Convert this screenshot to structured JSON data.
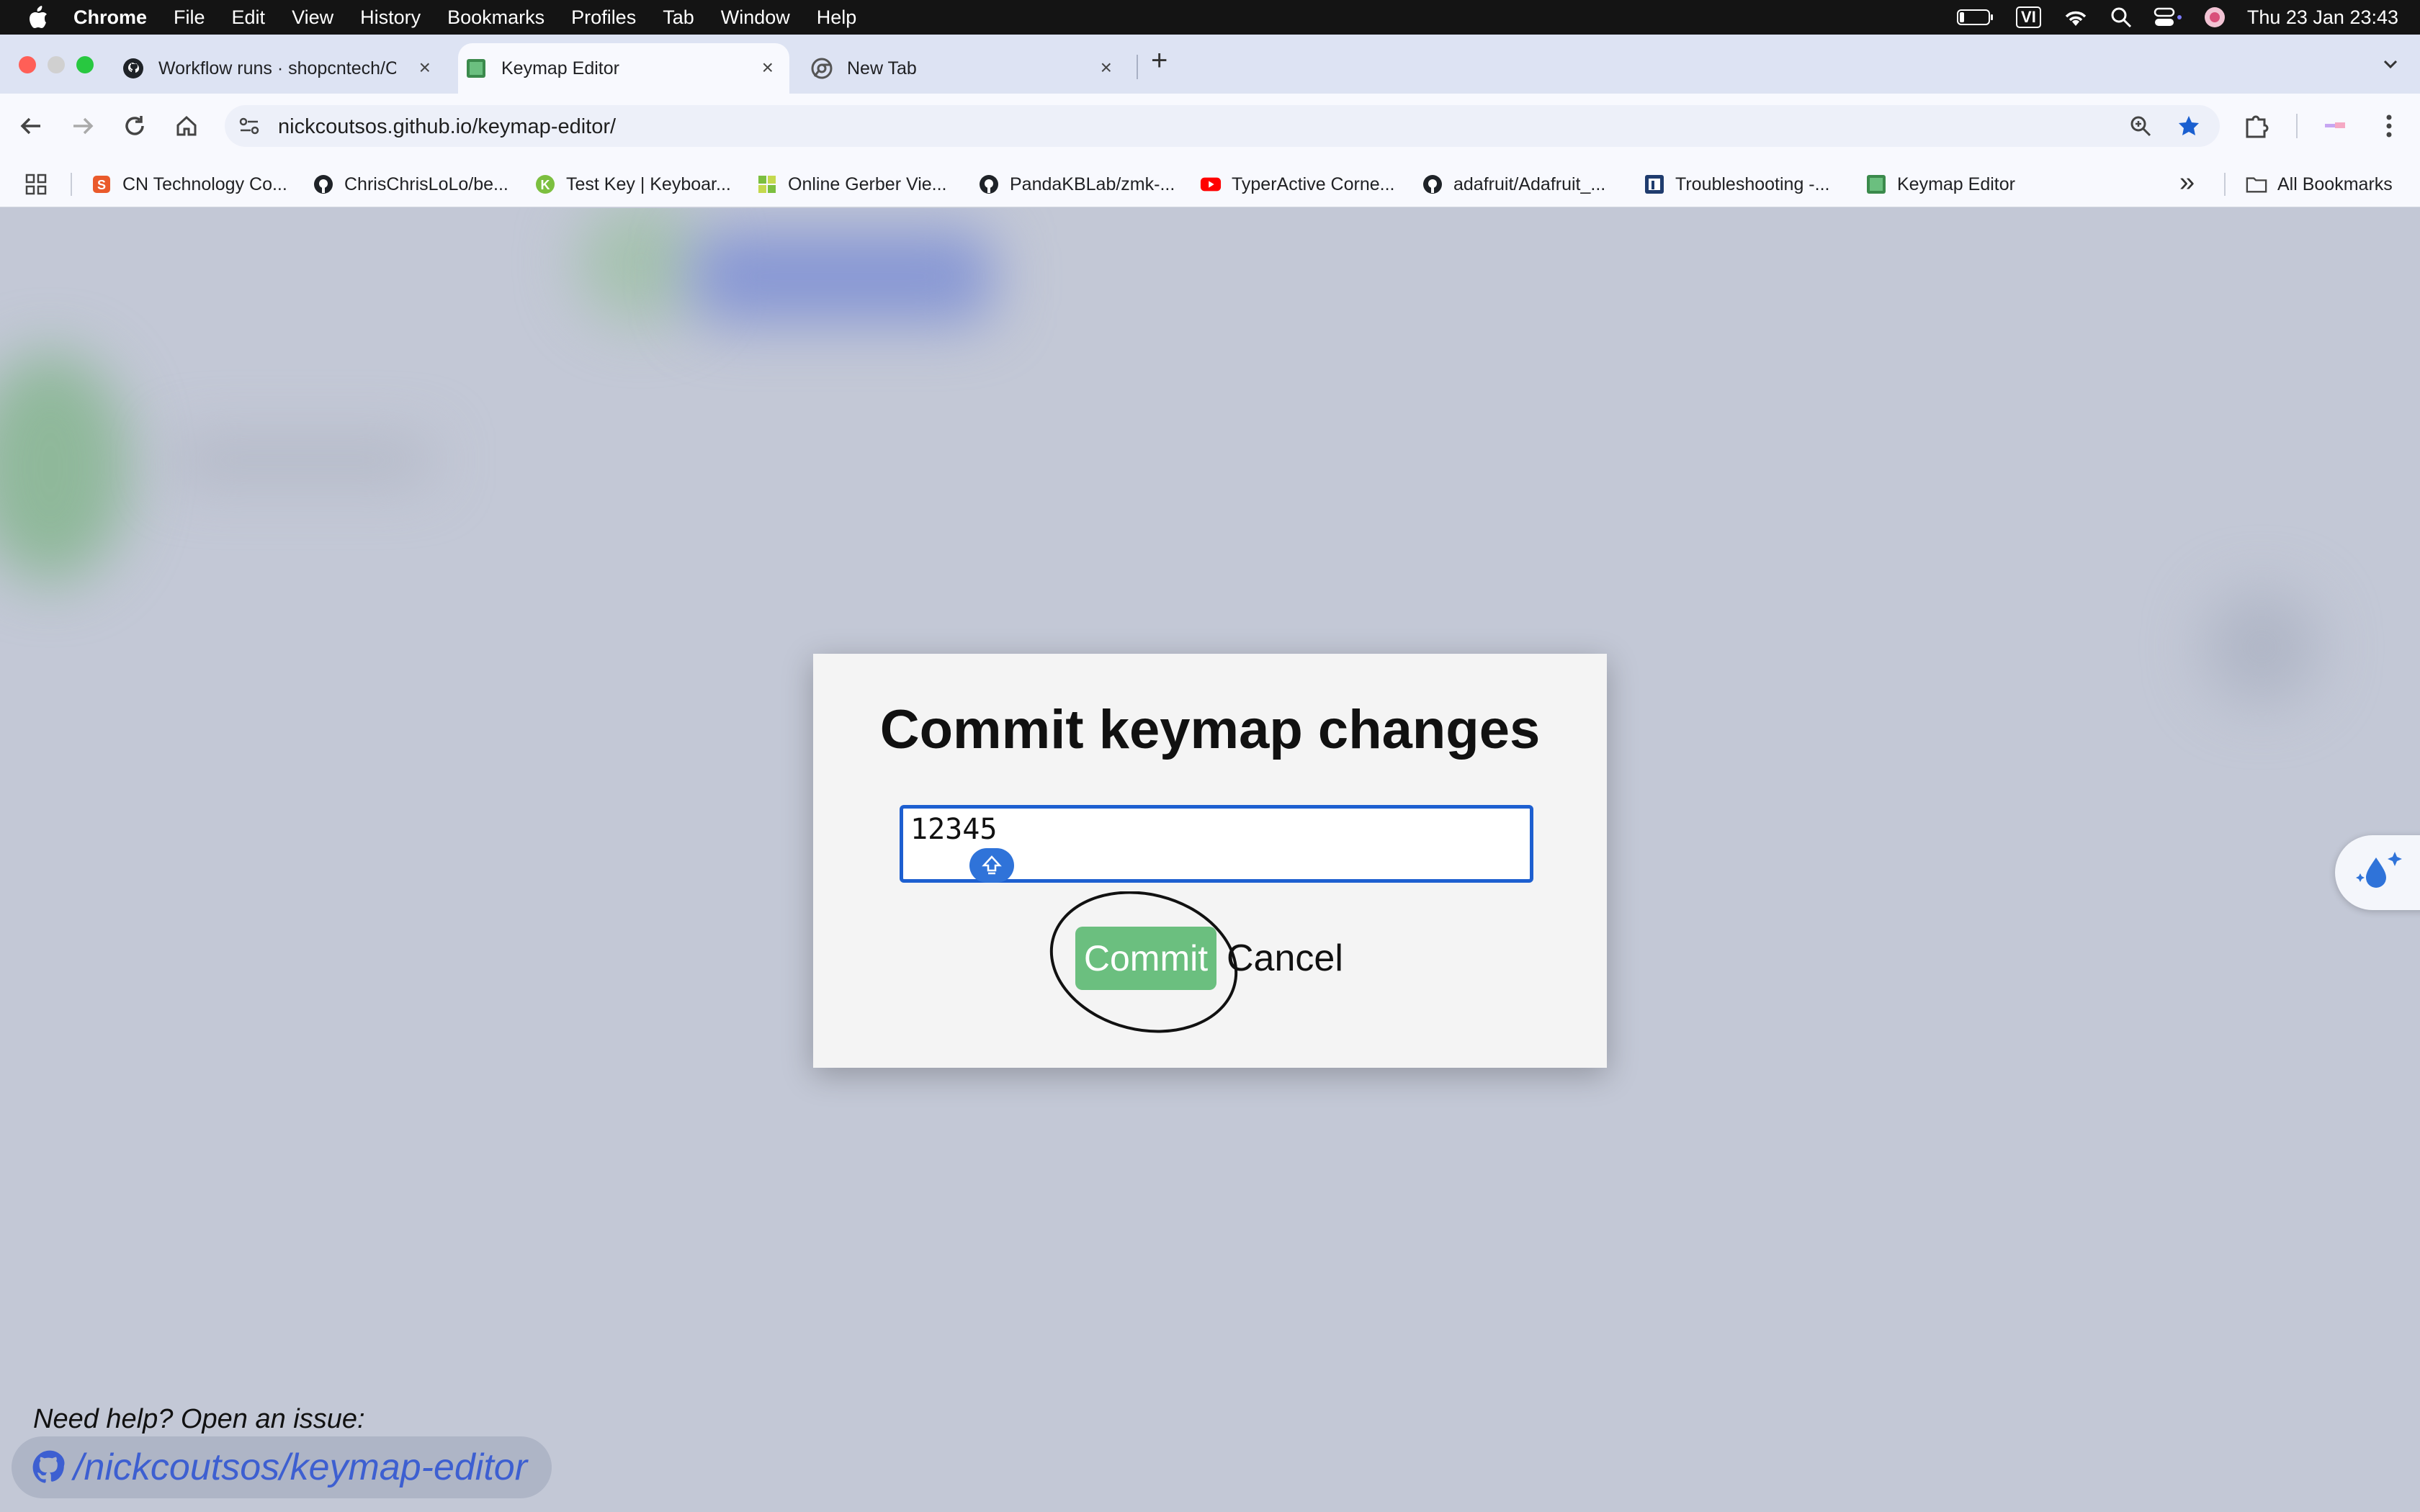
{
  "menubar": {
    "app_name": "Chrome",
    "items": [
      "File",
      "Edit",
      "View",
      "History",
      "Bookmarks",
      "Profiles",
      "Tab",
      "Window",
      "Help"
    ],
    "input_source": "VI",
    "clock": "Thu 23 Jan  23:43"
  },
  "tabs": [
    {
      "title": "Workflow runs · shopcntech/C",
      "close": "×"
    },
    {
      "title": "Keymap Editor",
      "close": "×"
    },
    {
      "title": "New Tab",
      "close": "×"
    }
  ],
  "new_tab_symbol": "+",
  "address_bar": {
    "url": "nickcoutsos.github.io/keymap-editor/"
  },
  "bookmarks": [
    {
      "label": "CN Technology Co...",
      "icon": "shop-icon"
    },
    {
      "label": "ChrisChrisLoLo/be...",
      "icon": "github-icon"
    },
    {
      "label": "Test Key | Keyboar...",
      "icon": "k-icon"
    },
    {
      "label": "Online Gerber Vie...",
      "icon": "gerber-icon"
    },
    {
      "label": "PandaKBLab/zmk-...",
      "icon": "github-icon"
    },
    {
      "label": "TyperActive Corne...",
      "icon": "youtube-icon"
    },
    {
      "label": "adafruit/Adafruit_...",
      "icon": "github-icon"
    },
    {
      "label": "Troubleshooting -...",
      "icon": "n-icon"
    },
    {
      "label": "Keymap Editor",
      "icon": "keymap-icon"
    }
  ],
  "bookmarks_overflow": "»",
  "all_bookmarks": "All Bookmarks",
  "modal": {
    "title": "Commit keymap changes",
    "message_value": "12345",
    "commit_label": "Commit",
    "cancel_label": "Cancel"
  },
  "footer": {
    "help_text": "Need help? Open an issue:",
    "repo_link": "/nickcoutsos/keymap-editor"
  },
  "colors": {
    "menubar_bg": "#141414",
    "tabstrip_bg": "#dde3f3",
    "page_overlay": "#c3c8d6",
    "commit_green": "#6bbf7f",
    "focus_blue": "#1d5fd0",
    "link_blue": "#3d5fd1"
  }
}
